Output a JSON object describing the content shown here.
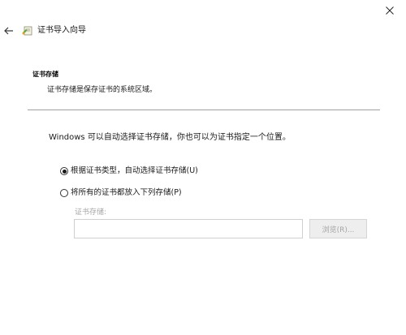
{
  "window": {
    "title": "证书导入向导",
    "close_icon": "close-icon",
    "back_icon": "back-arrow-icon",
    "wizard_icon": "certificate-wizard-icon"
  },
  "section": {
    "heading": "证书存储",
    "description": "证书存储是保存证书的系统区域。"
  },
  "main": {
    "intro": "Windows 可以自动选择证书存储，你也可以为证书指定一个位置。",
    "options": [
      {
        "label": "根据证书类型，自动选择证书存储(U)",
        "selected": true
      },
      {
        "label": "将所有的证书都放入下列存储(P)",
        "selected": false
      }
    ],
    "store_label": "证书存储:",
    "store_value": "",
    "browse_label": "浏览(R)..."
  },
  "colors": {
    "disabled_text": "#a6a6a6",
    "divider": "#a0a0a0"
  }
}
